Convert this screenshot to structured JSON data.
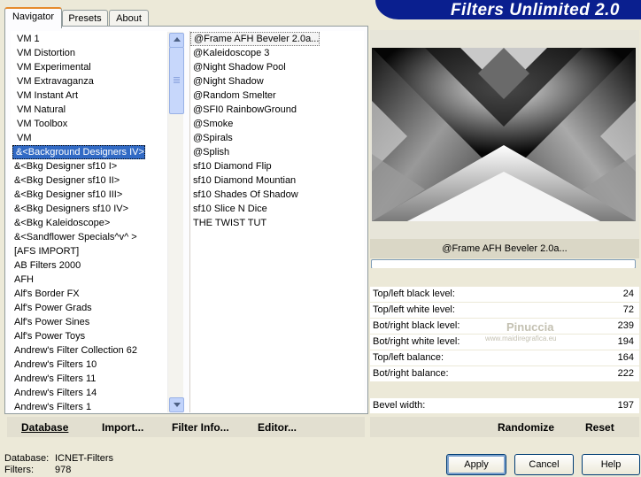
{
  "banner_title": "Filters Unlimited 2.0",
  "tabs": [
    "Navigator",
    "Presets",
    "About"
  ],
  "categories": {
    "items": [
      "VM 1",
      "VM Distortion",
      "VM Experimental",
      "VM Extravaganza",
      "VM Instant Art",
      "VM Natural",
      "VM Toolbox",
      "VM",
      "&<Background Designers IV>",
      "&<Bkg Designer sf10 I>",
      "&<Bkg Designer sf10 II>",
      "&<Bkg Designer sf10 III>",
      "&<Bkg Designers sf10 IV>",
      "&<Bkg Kaleidoscope>",
      "&<Sandflower Specials^v^ >",
      "[AFS IMPORT]",
      "AB Filters 2000",
      "AFH",
      "Alf's Border FX",
      "Alf's Power Grads",
      "Alf's Power Sines",
      "Alf's Power Toys",
      "Andrew's Filter Collection 62",
      "Andrew's Filters 10",
      "Andrew's Filters 11",
      "Andrew's Filters 14",
      "Andrew's Filters 1"
    ],
    "selected_index": 8
  },
  "filters": {
    "items": [
      "@Frame AFH Beveler 2.0a...",
      "@Kaleidoscope 3",
      "@Night Shadow Pool",
      "@Night Shadow",
      "@Random Smelter",
      "@SFI0 RainbowGround",
      "@Smoke",
      "@Spirals",
      "@Splish",
      "sf10 Diamond Flip",
      "sf10 Diamond Mountian",
      "sf10 Shades Of Shadow",
      "sf10 Slice N Dice",
      "THE TWIST TUT"
    ],
    "selected_index": 0
  },
  "link_buttons": {
    "database": "Database",
    "import": "Import...",
    "filter_info": "Filter Info...",
    "editor": "Editor..."
  },
  "filter_name": "@Frame AFH Beveler 2.0a...",
  "sliders": [
    {
      "label": "Top/left black level:",
      "value": "24"
    },
    {
      "label": "Top/left white level:",
      "value": "72"
    },
    {
      "label": "Bot/right black level:",
      "value": "239"
    },
    {
      "label": "Bot/right white level:",
      "value": "194"
    },
    {
      "label": "Top/left balance:",
      "value": "164"
    },
    {
      "label": "Bot/right balance:",
      "value": "222"
    },
    {
      "label": "Bevel width:",
      "value": "197"
    }
  ],
  "watermark": {
    "name": "Pinuccia",
    "site": "www.maidiregrafica.eu"
  },
  "randomize_label": "Randomize",
  "reset_label": "Reset",
  "status": {
    "database_label": "Database:",
    "database_value": "ICNET-Filters",
    "filters_label": "Filters:",
    "filters_value": "978"
  },
  "buttons": {
    "apply": "Apply",
    "cancel": "Cancel",
    "help": "Help"
  },
  "colors": {
    "banner": "#0a1f8f",
    "selection": "#316ac5",
    "window": "#ece9d8",
    "active_tab_accent": "#e68b2c"
  }
}
